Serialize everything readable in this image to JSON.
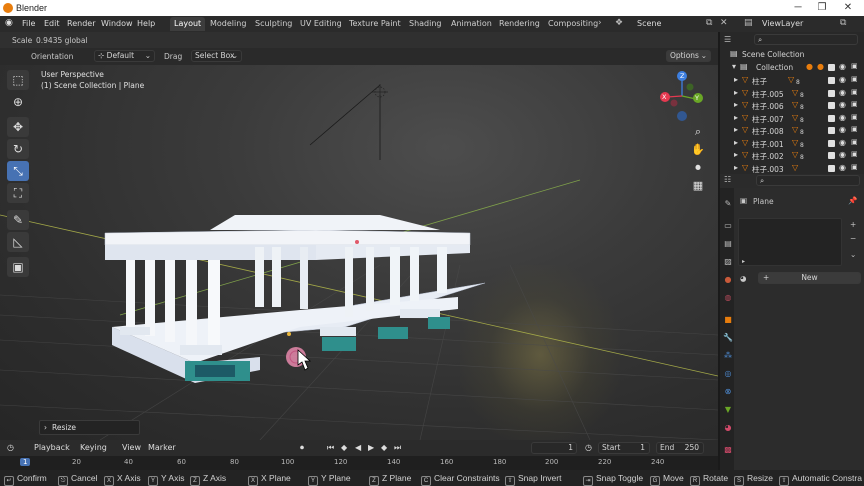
{
  "app": {
    "title": "Blender"
  },
  "window_controls": {
    "minimize": "─",
    "maximize": "❐",
    "close": "✕"
  },
  "menu": [
    "File",
    "Edit",
    "Render",
    "Window",
    "Help"
  ],
  "workspace_tabs": [
    {
      "label": "Layout",
      "active": true
    },
    {
      "label": "Modeling"
    },
    {
      "label": "Sculpting"
    },
    {
      "label": "UV Editing"
    },
    {
      "label": "Texture Paint"
    },
    {
      "label": "Shading"
    },
    {
      "label": "Animation"
    },
    {
      "label": "Rendering"
    },
    {
      "label": "Compositing"
    }
  ],
  "scene": {
    "name": "Scene",
    "view_layer": "ViewLayer"
  },
  "header": {
    "scale_label": "Scale",
    "scale_value": "0.9435 global",
    "orientation_label": "Orientation",
    "orientation_value": "Default",
    "drag_label": "Drag",
    "drag_value": "Select Box",
    "options_label": "Options"
  },
  "viewport": {
    "view_name": "User Perspective",
    "context": "(1) Scene Collection | Plane",
    "operator_panel": "Resize",
    "axes": {
      "x": "X",
      "y": "Y",
      "z": "Z"
    }
  },
  "timeline": {
    "playback_label": "Playback",
    "keying_label": "Keying",
    "view_label": "View",
    "marker_label": "Marker",
    "current_frame": "1",
    "start_label": "Start",
    "start_value": "1",
    "end_label": "End",
    "end_value": "250",
    "ruler_current": "1",
    "ruler_ticks": [
      "20",
      "40",
      "60",
      "80",
      "100",
      "120",
      "140",
      "160",
      "180",
      "200",
      "220",
      "240"
    ]
  },
  "status_bar": [
    {
      "key": "↵",
      "label": "Confirm"
    },
    {
      "key": "⎋",
      "label": "Cancel"
    },
    {
      "key": "X",
      "label": "X Axis"
    },
    {
      "key": "Y",
      "label": "Y Axis"
    },
    {
      "key": "Z",
      "label": "Z Axis"
    },
    {
      "key": "X",
      "label": "X Plane"
    },
    {
      "key": "Y",
      "label": "Y Plane"
    },
    {
      "key": "Z",
      "label": "Z Plane"
    },
    {
      "key": "C",
      "label": "Clear Constraints"
    },
    {
      "key": "⇧",
      "label": "Snap Invert"
    },
    {
      "key": "⇥",
      "label": "Snap Toggle"
    },
    {
      "key": "G",
      "label": "Move"
    },
    {
      "key": "R",
      "label": "Rotate"
    },
    {
      "key": "S",
      "label": "Resize"
    },
    {
      "key": "⇧",
      "label": "Automatic Constra"
    }
  ],
  "outliner": {
    "root": "Scene Collection",
    "collection": "Collection",
    "items": [
      "柱子",
      "柱子.005",
      "柱子.006",
      "柱子.007",
      "柱子.008",
      "柱子.001",
      "柱子.002",
      "柱子.003"
    ],
    "modifier_count": "8"
  },
  "properties": {
    "object_name": "Plane",
    "new_button": "New"
  },
  "colors": {
    "accent": "#4772b3",
    "x_axis": "#e53950",
    "y_axis": "#6aa726",
    "z_axis": "#3d7fe0",
    "orange": "#e87d0d"
  }
}
